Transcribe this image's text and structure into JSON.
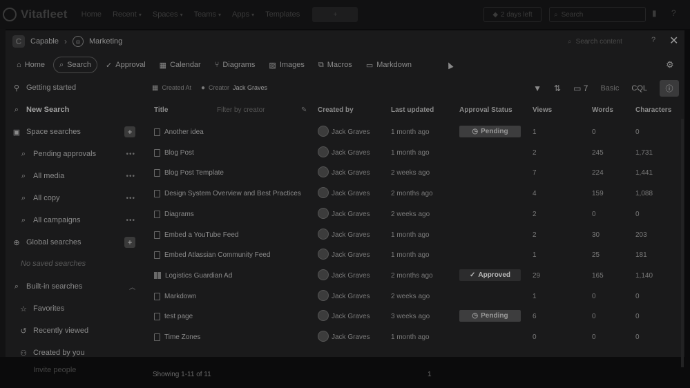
{
  "topbar": {
    "brand": "Vitafleet",
    "nav": [
      {
        "label": "Home",
        "dropdown": false
      },
      {
        "label": "Recent",
        "dropdown": true
      },
      {
        "label": "Spaces",
        "dropdown": true
      },
      {
        "label": "Teams",
        "dropdown": true
      },
      {
        "label": "Apps",
        "dropdown": true
      },
      {
        "label": "Templates",
        "dropdown": false
      }
    ],
    "trial": "2 days left",
    "search_placeholder": "Search"
  },
  "dialog": {
    "breadcrumb_space": "Capable",
    "breadcrumb_page": "Marketing",
    "search_placeholder": "Search content",
    "tabs": [
      {
        "label": "Home",
        "icon": "home-icon"
      },
      {
        "label": "Search",
        "icon": "search-icon",
        "active": true
      },
      {
        "label": "Approval",
        "icon": "check-circle-icon"
      },
      {
        "label": "Calendar",
        "icon": "calendar-icon"
      },
      {
        "label": "Diagrams",
        "icon": "diagram-icon"
      },
      {
        "label": "Images",
        "icon": "image-icon"
      },
      {
        "label": "Macros",
        "icon": "macro-icon"
      },
      {
        "label": "Markdown",
        "icon": "markdown-icon"
      }
    ]
  },
  "sidebar": {
    "getting_started": "Getting started",
    "new_search": "New Search",
    "space_searches": "Space searches",
    "space_items": [
      "Pending approvals",
      "All media",
      "All copy",
      "All campaigns"
    ],
    "global_searches": "Global searches",
    "no_saved": "No saved searches",
    "builtin": "Built-in searches",
    "builtin_items": [
      "Favorites",
      "Recently viewed",
      "Created by you"
    ]
  },
  "filters": {
    "created_at": "Created At",
    "creator_label": "Creator",
    "creator_value": "Jack Graves",
    "columns_count": "7",
    "basic": "Basic",
    "cql": "CQL",
    "filter_popup": "Filter by creator"
  },
  "table": {
    "headers": [
      "Title",
      "Created by",
      "Last updated",
      "Approval Status",
      "Views",
      "Words",
      "Characters"
    ],
    "rows": [
      {
        "title": "Another idea",
        "icon": "page",
        "creator": "Jack Graves",
        "updated": "1 month ago",
        "status": "Pending",
        "views": "1",
        "words": "0",
        "chars": "0"
      },
      {
        "title": "Blog Post",
        "icon": "page",
        "creator": "Jack Graves",
        "updated": "1 month ago",
        "status": "",
        "views": "2",
        "words": "245",
        "chars": "1,731"
      },
      {
        "title": "Blog Post Template",
        "icon": "page",
        "creator": "Jack Graves",
        "updated": "2 weeks ago",
        "status": "",
        "views": "7",
        "words": "224",
        "chars": "1,441"
      },
      {
        "title": "Design System Overview and Best Practices",
        "icon": "page",
        "creator": "Jack Graves",
        "updated": "2 months ago",
        "status": "",
        "views": "4",
        "words": "159",
        "chars": "1,088"
      },
      {
        "title": "Diagrams",
        "icon": "page",
        "creator": "Jack Graves",
        "updated": "2 weeks ago",
        "status": "",
        "views": "2",
        "words": "0",
        "chars": "0"
      },
      {
        "title": "Embed a YouTube Feed",
        "icon": "page",
        "creator": "Jack Graves",
        "updated": "1 month ago",
        "status": "",
        "views": "2",
        "words": "30",
        "chars": "203"
      },
      {
        "title": "Embed Atlassian Community Feed",
        "icon": "page",
        "creator": "Jack Graves",
        "updated": "1 month ago",
        "status": "",
        "views": "1",
        "words": "25",
        "chars": "181"
      },
      {
        "title": "Logistics Guardian Ad",
        "icon": "board",
        "creator": "Jack Graves",
        "updated": "2 months ago",
        "status": "Approved",
        "views": "29",
        "words": "165",
        "chars": "1,140"
      },
      {
        "title": "Markdown",
        "icon": "page",
        "creator": "Jack Graves",
        "updated": "2 weeks ago",
        "status": "",
        "views": "1",
        "words": "0",
        "chars": "0"
      },
      {
        "title": "test page",
        "icon": "page",
        "creator": "Jack Graves",
        "updated": "3 weeks ago",
        "status": "Pending",
        "views": "6",
        "words": "0",
        "chars": "0"
      },
      {
        "title": "Time Zones",
        "icon": "page",
        "creator": "Jack Graves",
        "updated": "1 month ago",
        "status": "",
        "views": "0",
        "words": "0",
        "chars": "0"
      }
    ],
    "footer": "Showing 1-11 of 11",
    "page": "1"
  },
  "bottom": {
    "invite": "Invite people"
  }
}
